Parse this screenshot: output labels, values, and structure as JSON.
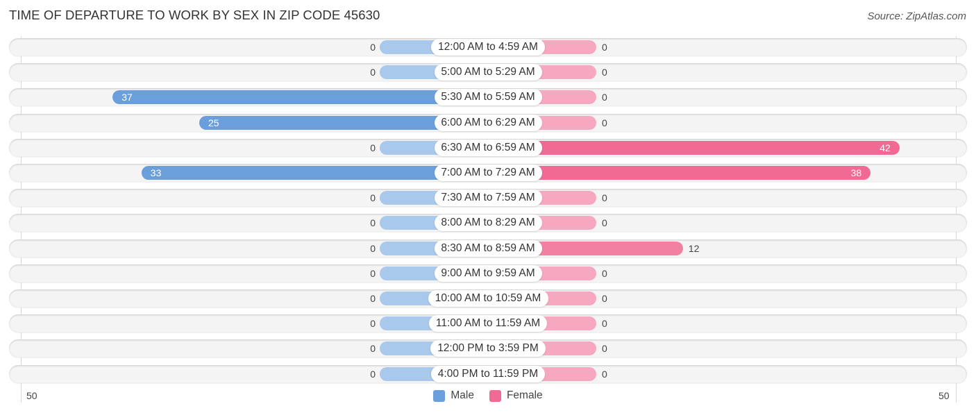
{
  "title": "TIME OF DEPARTURE TO WORK BY SEX IN ZIP CODE 45630",
  "source": "Source: ZipAtlas.com",
  "colors": {
    "male": "#6a9fdc",
    "male_light": "#a8c8ec",
    "female": "#f06a94",
    "female_light": "#f6a8c0"
  },
  "chart_data": {
    "type": "bar",
    "orientation": "horizontal-diverging",
    "title": "TIME OF DEPARTURE TO WORK BY SEX IN ZIP CODE 45630",
    "categories": [
      "12:00 AM to 4:59 AM",
      "5:00 AM to 5:29 AM",
      "5:30 AM to 5:59 AM",
      "6:00 AM to 6:29 AM",
      "6:30 AM to 6:59 AM",
      "7:00 AM to 7:29 AM",
      "7:30 AM to 7:59 AM",
      "8:00 AM to 8:29 AM",
      "8:30 AM to 8:59 AM",
      "9:00 AM to 9:59 AM",
      "10:00 AM to 10:59 AM",
      "11:00 AM to 11:59 AM",
      "12:00 PM to 3:59 PM",
      "4:00 PM to 11:59 PM"
    ],
    "series": [
      {
        "name": "Male",
        "values": [
          0,
          0,
          37,
          25,
          0,
          33,
          0,
          0,
          0,
          0,
          0,
          0,
          0,
          0
        ]
      },
      {
        "name": "Female",
        "values": [
          0,
          0,
          0,
          0,
          42,
          38,
          0,
          0,
          12,
          0,
          0,
          0,
          0,
          0
        ]
      }
    ],
    "xlim": [
      -50,
      50
    ],
    "tick_labels": {
      "left": "50",
      "right": "50"
    },
    "legend": {
      "position": "bottom-center",
      "entries": [
        "Male",
        "Female"
      ]
    },
    "grid": false
  }
}
